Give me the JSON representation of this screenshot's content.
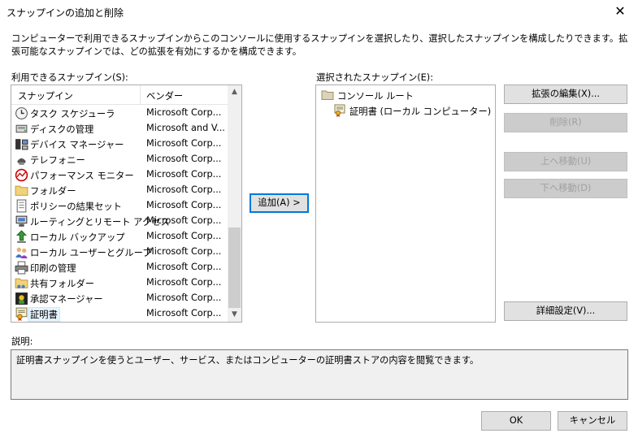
{
  "window": {
    "title": "スナップインの追加と削除"
  },
  "description": "コンピューターで利用できるスナップインからこのコンソールに使用するスナップインを選択したり、選択したスナップインを構成したりできます。拡張可能なスナップインでは、どの拡張を有効にするかを構成できます。",
  "available": {
    "label": "利用できるスナップイン(S):",
    "columns": {
      "snapin": "スナップイン",
      "vendor": "ベンダー"
    },
    "rows": [
      {
        "name": "タスク スケジューラ",
        "vendor": "Microsoft Corp...",
        "icon": "clock-icon"
      },
      {
        "name": "ディスクの管理",
        "vendor": "Microsoft and V...",
        "icon": "disk-icon"
      },
      {
        "name": "デバイス マネージャー",
        "vendor": "Microsoft Corp...",
        "icon": "device-manager-icon"
      },
      {
        "name": "テレフォニー",
        "vendor": "Microsoft Corp...",
        "icon": "telephony-icon"
      },
      {
        "name": "パフォーマンス モニター",
        "vendor": "Microsoft Corp...",
        "icon": "performance-monitor-icon"
      },
      {
        "name": "フォルダー",
        "vendor": "Microsoft Corp...",
        "icon": "folder-icon"
      },
      {
        "name": "ポリシーの結果セット",
        "vendor": "Microsoft Corp...",
        "icon": "policy-icon"
      },
      {
        "name": "ルーティングとリモート アクセス",
        "vendor": "Microsoft Corp...",
        "icon": "routing-icon"
      },
      {
        "name": "ローカル バックアップ",
        "vendor": "Microsoft Corp...",
        "icon": "backup-icon"
      },
      {
        "name": "ローカル ユーザーとグループ",
        "vendor": "Microsoft Corp...",
        "icon": "users-icon"
      },
      {
        "name": "印刷の管理",
        "vendor": "Microsoft Corp...",
        "icon": "printer-icon"
      },
      {
        "name": "共有フォルダー",
        "vendor": "Microsoft Corp...",
        "icon": "shared-folder-icon"
      },
      {
        "name": "承認マネージャー",
        "vendor": "Microsoft Corp...",
        "icon": "authorization-icon"
      },
      {
        "name": "証明書",
        "vendor": "Microsoft Corp...",
        "icon": "certificate-icon",
        "selected": true
      }
    ]
  },
  "add_button": "追加(A) >",
  "selected": {
    "label": "選択されたスナップイン(E):",
    "root": "コンソール ルート",
    "child": "証明書 (ローカル コンピューター)"
  },
  "buttons": {
    "edit_extensions": "拡張の編集(X)...",
    "remove": "削除(R)",
    "move_up": "上へ移動(U)",
    "move_down": "下へ移動(D)",
    "advanced": "詳細設定(V)...",
    "ok": "OK",
    "cancel": "キャンセル"
  },
  "explanation": {
    "label": "説明:",
    "text": "証明書スナップインを使うとユーザー、サービス、またはコンピューターの証明書ストアの内容を閲覧できます。"
  },
  "colors": {
    "default_button_border": "#0078d7",
    "selection": "#e5f3ff",
    "disabled_text": "#a0a0a0"
  }
}
